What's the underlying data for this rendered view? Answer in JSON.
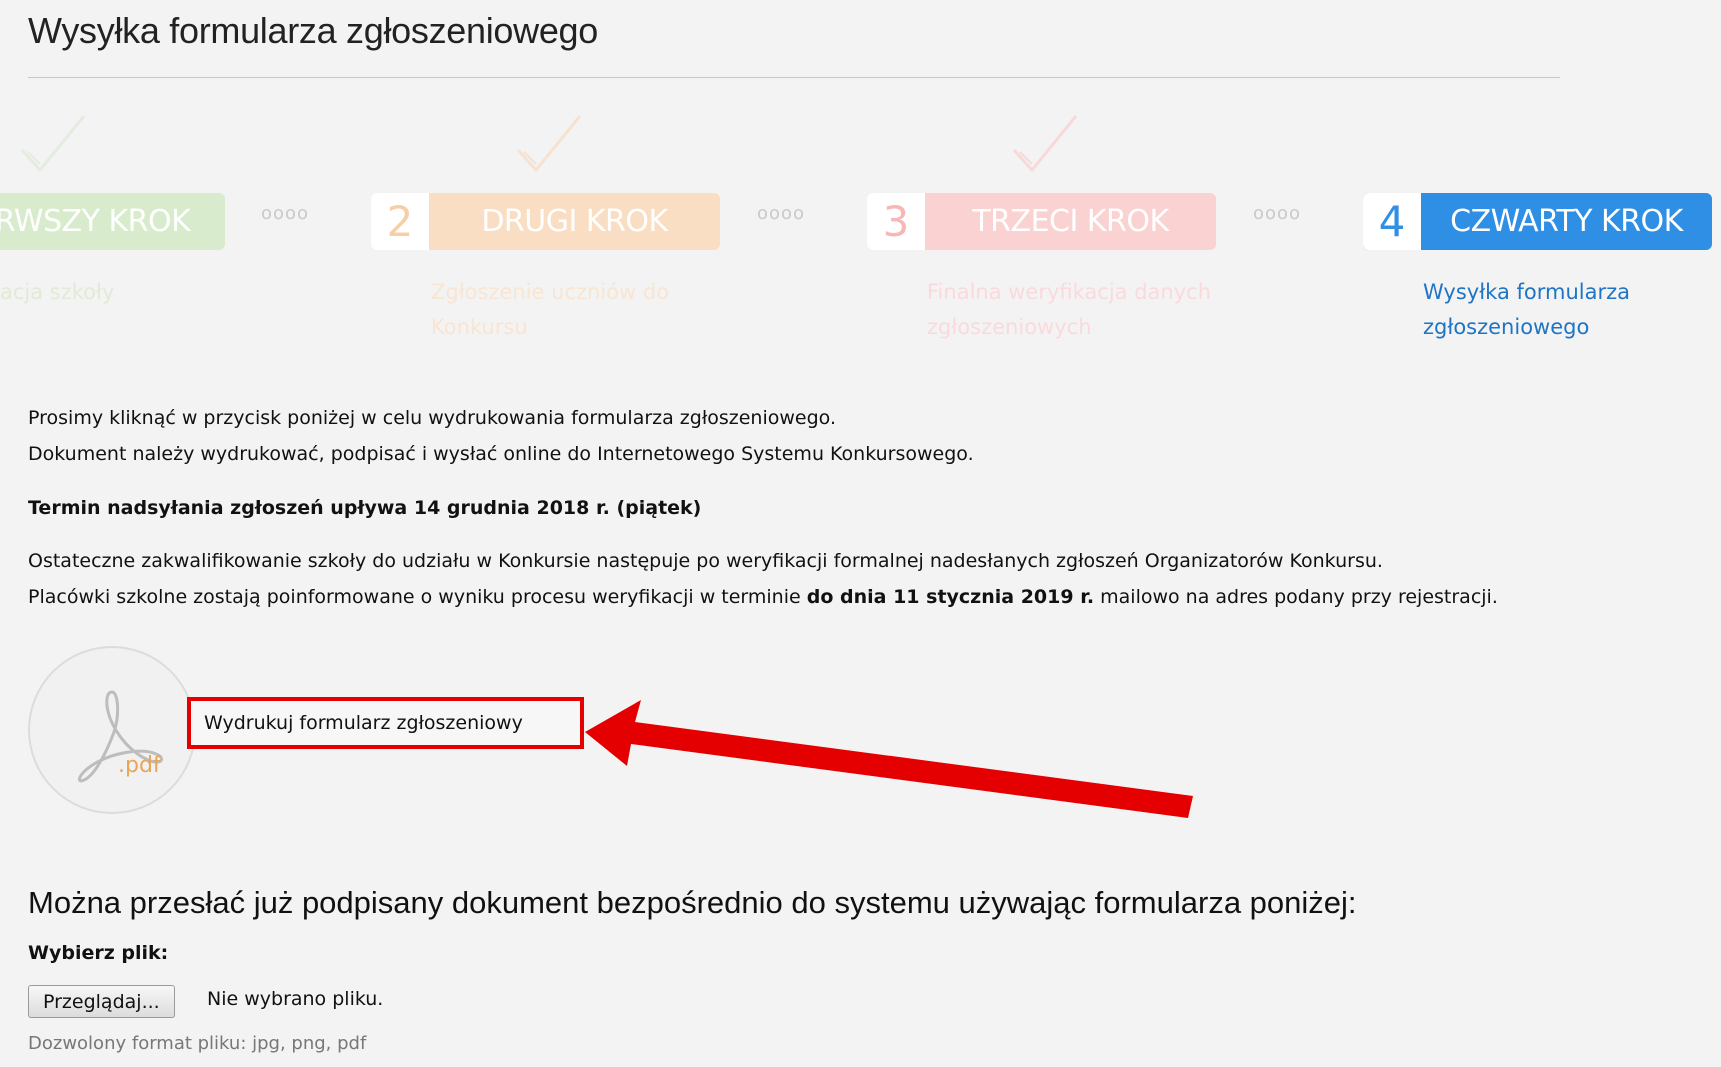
{
  "page": {
    "title": "Wysyłka formularza zgłoszeniowego"
  },
  "steps": [
    {
      "number": "",
      "label": "RWSZY KROK",
      "description": "acja szkoły",
      "state": "done",
      "color": "#d8eccd"
    },
    {
      "number": "2",
      "label": "DRUGI KROK",
      "description": "Zgłoszenie uczniów do Konkursu",
      "state": "done",
      "color": "#f9dec4"
    },
    {
      "number": "3",
      "label": "TRZECI KROK",
      "description": "Finalna weryfikacja danych zgłoszeniowych",
      "state": "done",
      "color": "#fbd2d2"
    },
    {
      "number": "4",
      "label": "CZWARTY KROK",
      "description": "Wysyłka formularza zgłoszeniowego",
      "state": "active",
      "color": "#2f8fe4"
    }
  ],
  "step_separator": "oooo",
  "instructions": {
    "line1": "Prosimy kliknąć w przycisk poniżej w celu wydrukowania formularza zgłoszeniowego.",
    "line2": "Dokument należy wydrukować, podpisać  i wysłać online do Internetowego Systemu Konkursowego.",
    "deadline": "Termin nadsyłania zgłoszeń upływa 14 grudnia 2018 r. (piątek)",
    "qualification_line1": "Ostateczne zakwalifikowanie szkoły do udziału w Konkursie następuje po weryfikacji formalnej nadesłanych zgłoszeń Organizatorów Konkursu.",
    "qualification_line2_pre": "Placówki szkolne zostają poinformowane o wyniku procesu weryfikacji w terminie ",
    "qualification_line2_bold": "do dnia 11 stycznia 2019 r.",
    "qualification_line2_post": " mailowo na adres podany przy rejestracji."
  },
  "print": {
    "icon": "pdf-icon",
    "icon_text": ".pdf",
    "link_label": "Wydrukuj formularz zgłoszeniowy"
  },
  "upload": {
    "heading": "Można przesłać już podpisany dokument bezpośrednio do systemu używając formularza poniżej:",
    "file_label": "Wybierz plik:",
    "browse_label": "Przeglądaj...",
    "file_status": "Nie wybrano pliku.",
    "hint": "Dozwolony format pliku: jpg, png, pdf"
  },
  "annotation": {
    "color": "#e40000"
  }
}
